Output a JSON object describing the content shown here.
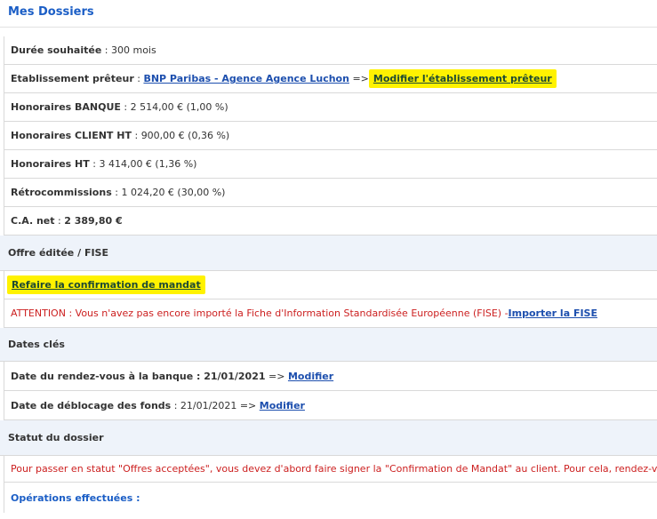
{
  "page": {
    "title": "Mes Dossiers"
  },
  "loan": {
    "duree_label": "Durée souhaitée",
    "duree_value": "300 mois",
    "etab_label": "Etablissement prêteur",
    "etab_link": "BNP Paribas - Agence Agence Luchon",
    "arrow": "=>",
    "modify_etab": "Modifier l'établissement prêteur",
    "hon_banque_label": "Honoraires BANQUE",
    "hon_banque_value": "2 514,00 € (1,00 %)",
    "hon_client_label": "Honoraires CLIENT HT",
    "hon_client_value": "900,00 € (0,36 %)",
    "hon_ht_label": "Honoraires HT",
    "hon_ht_value": "3 414,00 € (1,36 %)",
    "retro_label": "Rétrocommissions",
    "retro_value": "1 024,20 € (30,00 %)",
    "ca_label": "C.A. net",
    "ca_value": "2 389,80 €"
  },
  "offre": {
    "title": "Offre éditée / FISE",
    "redo_mandate": "Refaire la confirmation de mandat",
    "warning": "ATTENTION : Vous n'avez pas encore importé la Fiche d'Information Standardisée Européenne (FISE) - ",
    "import_link": "Importer la FISE"
  },
  "dates": {
    "title": "Dates clés",
    "rdv_label": "Date du rendez-vous à la banque",
    "rdv_value": "21/01/2021",
    "arrow": "=>",
    "modify": "Modifier",
    "deblocage_label": "Date de déblocage des fonds",
    "deblocage_value": "21/01/2021"
  },
  "statut": {
    "title": "Statut du dossier",
    "message": "Pour passer en statut \"Offres acceptées\", vous devez d'abord faire signer la \"Confirmation de Mandat\" au client. Pour cela, rendez-vous",
    "operations": "Opérations effectuées :"
  }
}
